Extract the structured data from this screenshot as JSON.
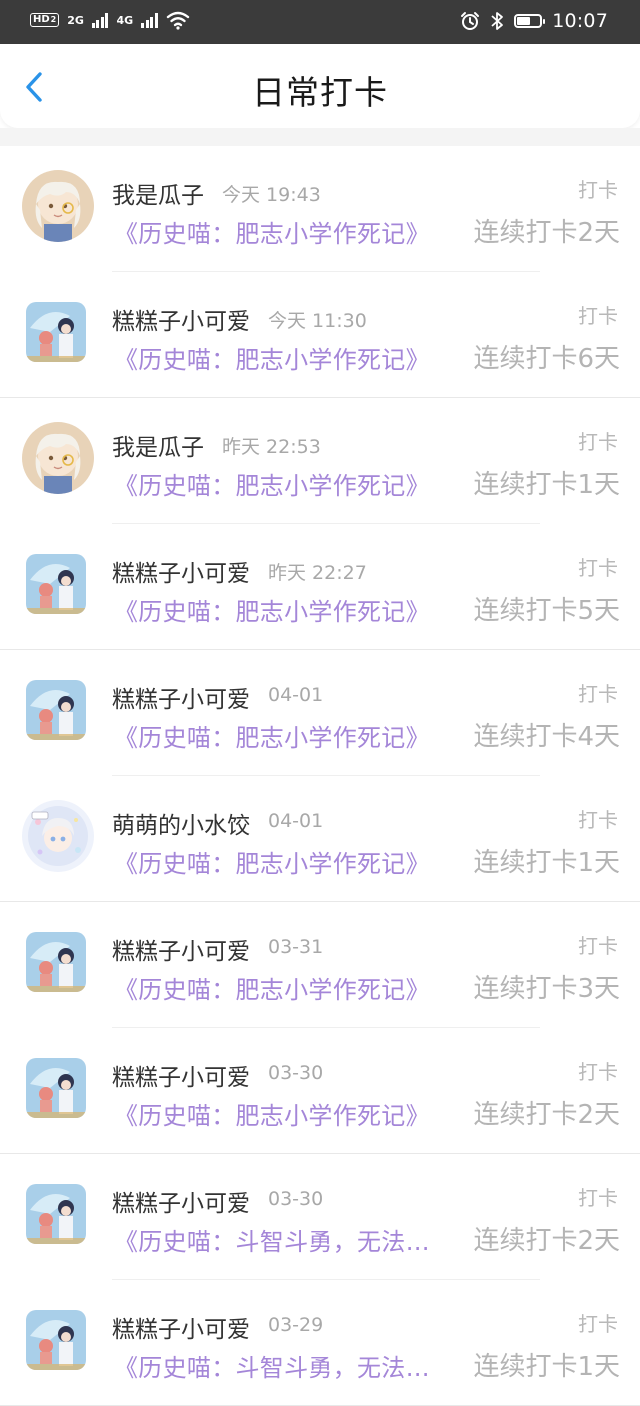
{
  "status_bar": {
    "hd": "HD",
    "sim_slot": "2",
    "net1": "2G",
    "net2": "4G",
    "time": "10:07",
    "battery_level": 0.6
  },
  "header": {
    "title": "日常打卡"
  },
  "items": [
    {
      "name": "我是瓜子",
      "time": "今天 19:43",
      "tag": "打卡",
      "book": "《历史喵：肥志小学作死记》",
      "streak": "连续打卡2天",
      "avatar": "anime-white-hair-avatar"
    },
    {
      "name": "糕糕子小可爱",
      "time": "今天 11:30",
      "tag": "打卡",
      "book": "《历史喵：肥志小学作死记》",
      "streak": "连续打卡6天",
      "avatar": "umbrella-kids-avatar"
    },
    {
      "name": "我是瓜子",
      "time": "昨天 22:53",
      "tag": "打卡",
      "book": "《历史喵：肥志小学作死记》",
      "streak": "连续打卡1天",
      "avatar": "anime-white-hair-avatar"
    },
    {
      "name": "糕糕子小可爱",
      "time": "昨天 22:27",
      "tag": "打卡",
      "book": "《历史喵：肥志小学作死记》",
      "streak": "连续打卡5天",
      "avatar": "umbrella-kids-avatar"
    },
    {
      "name": "糕糕子小可爱",
      "time": "04-01",
      "tag": "打卡",
      "book": "《历史喵：肥志小学作死记》",
      "streak": "连续打卡4天",
      "avatar": "umbrella-kids-avatar"
    },
    {
      "name": "萌萌的小水饺",
      "time": "04-01",
      "tag": "打卡",
      "book": "《历史喵：肥志小学作死记》",
      "streak": "连续打卡1天",
      "avatar": "pastel-girl-avatar"
    },
    {
      "name": "糕糕子小可爱",
      "time": "03-31",
      "tag": "打卡",
      "book": "《历史喵：肥志小学作死记》",
      "streak": "连续打卡3天",
      "avatar": "umbrella-kids-avatar"
    },
    {
      "name": "糕糕子小可爱",
      "time": "03-30",
      "tag": "打卡",
      "book": "《历史喵：肥志小学作死记》",
      "streak": "连续打卡2天",
      "avatar": "umbrella-kids-avatar"
    },
    {
      "name": "糕糕子小可爱",
      "time": "03-30",
      "tag": "打卡",
      "book": "《历史喵：斗智斗勇，无法…",
      "streak": "连续打卡2天",
      "avatar": "umbrella-kids-avatar"
    },
    {
      "name": "糕糕子小可爱",
      "time": "03-29",
      "tag": "打卡",
      "book": "《历史喵：斗智斗勇，无法…",
      "streak": "连续打卡1天",
      "avatar": "umbrella-kids-avatar"
    }
  ]
}
